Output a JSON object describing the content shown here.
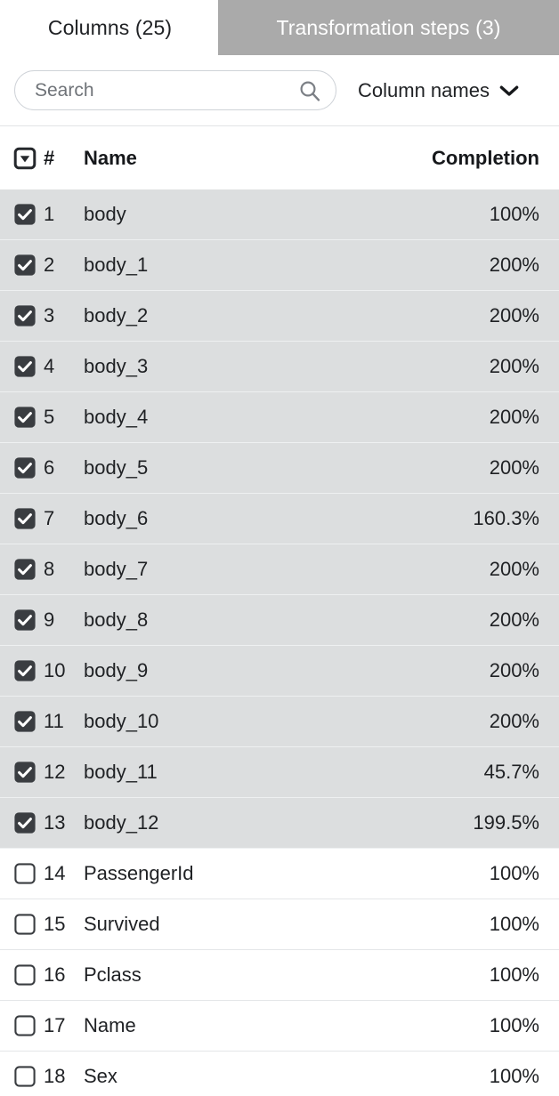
{
  "tabs": [
    {
      "label": "Columns (25)",
      "active": false,
      "name": "tab-columns"
    },
    {
      "label": "Transformation steps (3)",
      "active": true,
      "name": "tab-transformation-steps"
    }
  ],
  "toolbar": {
    "search_placeholder": "Search",
    "search_value": "",
    "dropdown_label": "Column names"
  },
  "table": {
    "headers": {
      "number": "#",
      "name": "Name",
      "completion": "Completion"
    },
    "rows": [
      {
        "num": "1",
        "name": "body",
        "completion": "100%",
        "checked": true
      },
      {
        "num": "2",
        "name": "body_1",
        "completion": "200%",
        "checked": true
      },
      {
        "num": "3",
        "name": "body_2",
        "completion": "200%",
        "checked": true
      },
      {
        "num": "4",
        "name": "body_3",
        "completion": "200%",
        "checked": true
      },
      {
        "num": "5",
        "name": "body_4",
        "completion": "200%",
        "checked": true
      },
      {
        "num": "6",
        "name": "body_5",
        "completion": "200%",
        "checked": true
      },
      {
        "num": "7",
        "name": "body_6",
        "completion": "160.3%",
        "checked": true
      },
      {
        "num": "8",
        "name": "body_7",
        "completion": "200%",
        "checked": true
      },
      {
        "num": "9",
        "name": "body_8",
        "completion": "200%",
        "checked": true
      },
      {
        "num": "10",
        "name": "body_9",
        "completion": "200%",
        "checked": true
      },
      {
        "num": "11",
        "name": "body_10",
        "completion": "200%",
        "checked": true
      },
      {
        "num": "12",
        "name": "body_11",
        "completion": "45.7%",
        "checked": true
      },
      {
        "num": "13",
        "name": "body_12",
        "completion": "199.5%",
        "checked": true
      },
      {
        "num": "14",
        "name": "PassengerId",
        "completion": "100%",
        "checked": false
      },
      {
        "num": "15",
        "name": "Survived",
        "completion": "100%",
        "checked": false
      },
      {
        "num": "16",
        "name": "Pclass",
        "completion": "100%",
        "checked": false
      },
      {
        "num": "17",
        "name": "Name",
        "completion": "100%",
        "checked": false
      },
      {
        "num": "18",
        "name": "Sex",
        "completion": "100%",
        "checked": false
      }
    ]
  },
  "colors": {
    "active_tab_bg": "#aaaaaa",
    "selected_row_bg": "#dcdedf",
    "checkbox_fill": "#3a3d41",
    "text": "#1f2124"
  }
}
